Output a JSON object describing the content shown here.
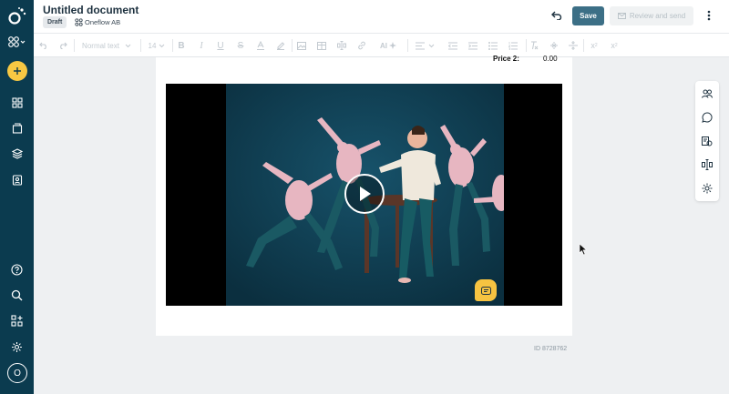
{
  "document": {
    "title": "Untitled document",
    "status": "Draft",
    "company": "Oneflow AB",
    "id_label": "ID 8728762",
    "price_label": "Price 2:",
    "price_value": "0.00"
  },
  "header": {
    "save_label": "Save",
    "review_label": "Review and send"
  },
  "toolbar": {
    "text_style": "Normal text",
    "font_size": "14",
    "ai_label": "AI",
    "icons": [
      "undo-icon",
      "redo-icon",
      "bold-icon",
      "italic-icon",
      "underline-icon",
      "strikethrough-icon",
      "text-color-icon",
      "highlight-icon",
      "image-icon",
      "table-icon",
      "form-field-icon",
      "link-icon",
      "ai-assist-icon",
      "align-left-icon",
      "outdent-icon",
      "indent-icon",
      "bullet-list-icon",
      "numbered-list-icon",
      "clear-format-icon",
      "line-break-icon",
      "divider-icon",
      "superscript-icon",
      "subscript-icon"
    ]
  },
  "sidebar": {
    "avatar_initial": "O",
    "icons": [
      "oneflow-logo-icon",
      "apps-icon",
      "add-icon",
      "dashboard-icon",
      "documents-icon",
      "templates-icon",
      "contacts-icon",
      "help-icon",
      "search-icon",
      "marketplace-icon",
      "settings-icon"
    ]
  },
  "right_panel": {
    "icons": [
      "participants-icon",
      "comments-icon",
      "document-details-icon",
      "content-blocks-icon",
      "document-settings-icon"
    ]
  },
  "colors": {
    "sidebar": "#0b3b4f",
    "accent": "#f7c843",
    "save": "#3c6f86",
    "video_background": "#103c4e"
  }
}
